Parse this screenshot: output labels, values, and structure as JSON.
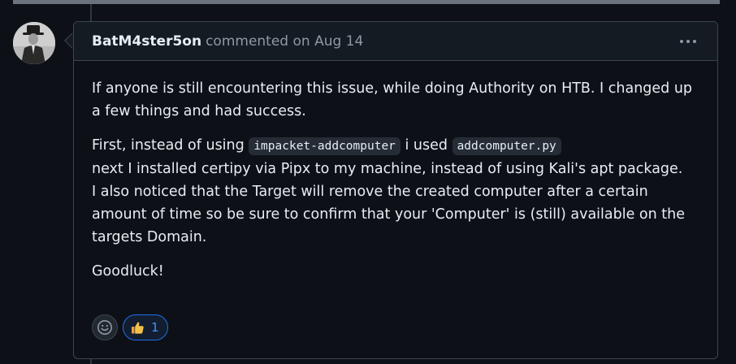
{
  "comment": {
    "author": "BatM4ster5on",
    "meta": "commented on Aug 14",
    "paragraphs": {
      "p1": "If anyone is still encountering this issue, while doing Authority on HTB. I changed up a few things and had success.",
      "p2_before_code1": "First, instead of using ",
      "p2_code1": "impacket-addcomputer",
      "p2_between": " i used ",
      "p2_code2": "addcomputer.py",
      "p2_line2": "next I installed certipy via Pipx to my machine, instead of using Kali's apt package.",
      "p2_line3": "I also noticed that the Target will remove the created computer after a certain amount of time so be sure to confirm that your 'Computer' is (still) available on the targets Domain.",
      "p3": "Goodluck!"
    },
    "reactions": [
      {
        "emoji": "thumbs-up-icon",
        "count": "1"
      }
    ]
  },
  "colors": {
    "background": "#0d1117",
    "header_bg": "#151b23",
    "border": "#3d444d",
    "text": "#e6edf3",
    "muted": "#9198a1",
    "accent": "#1f6feb",
    "accent_text": "#4493f8",
    "code_bg": "#262c36"
  },
  "icons": {
    "more": "kebab-horizontal-icon",
    "emoji_picker": "smiley-icon"
  }
}
